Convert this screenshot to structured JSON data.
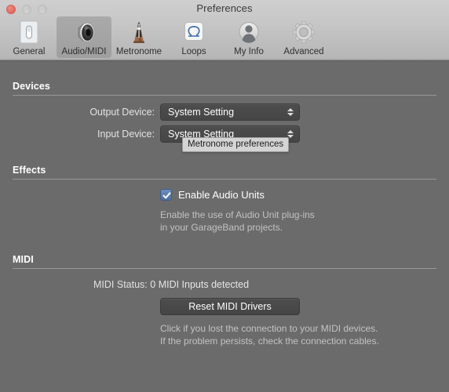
{
  "window": {
    "title": "Preferences",
    "controls": {
      "close": "close-button",
      "minimize": "minimize-button",
      "zoom": "zoom-button"
    }
  },
  "toolbar": {
    "items": [
      {
        "label": "General",
        "icon": "light-switch-icon",
        "selected": false
      },
      {
        "label": "Audio/MIDI",
        "icon": "speaker-icon",
        "selected": true
      },
      {
        "label": "Metronome",
        "icon": "metronome-icon",
        "selected": false
      },
      {
        "label": "Loops",
        "icon": "loop-omega-icon",
        "selected": false
      },
      {
        "label": "My Info",
        "icon": "person-icon",
        "selected": false
      },
      {
        "label": "Advanced",
        "icon": "gear-icon",
        "selected": false
      }
    ]
  },
  "sections": {
    "devices": {
      "header": "Devices",
      "output_label": "Output Device:",
      "output_value": "System Setting",
      "input_label": "Input Device:",
      "input_value": "System Setting"
    },
    "effects": {
      "header": "Effects",
      "checkbox_label": "Enable Audio Units",
      "checkbox_checked": true,
      "help_line_1": "Enable the use of Audio Unit plug-ins",
      "help_line_2": "in your GarageBand projects."
    },
    "midi": {
      "header": "MIDI",
      "status_label": "MIDI Status:",
      "status_value": "0 MIDI Inputs detected",
      "reset_button": "Reset MIDI Drivers",
      "help_line_1": "Click if you lost the connection to your MIDI devices.",
      "help_line_2": "If the problem persists, check the connection cables."
    }
  },
  "tooltip": {
    "text": "Metronome preferences"
  },
  "colors": {
    "content_bg": "#6b6b6b",
    "toolbar_bg": "#c6c6c6",
    "checkbox_accent": "#5b7fad",
    "close_button": "#e0695f",
    "control_fill": "#4a4a4a"
  }
}
